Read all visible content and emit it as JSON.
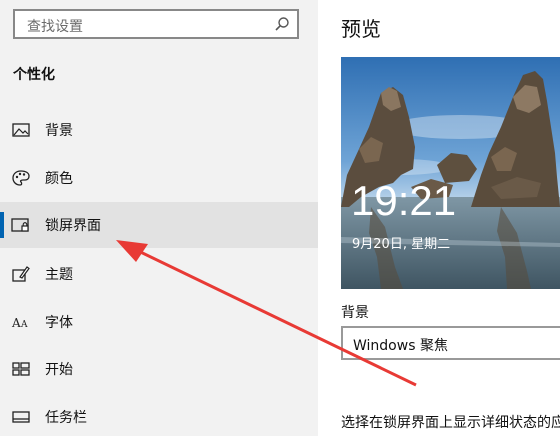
{
  "search": {
    "placeholder": "查找设置"
  },
  "sidebar": {
    "section_title": "个性化",
    "items": [
      {
        "label": "背景",
        "icon": "image-icon"
      },
      {
        "label": "颜色",
        "icon": "palette-icon"
      },
      {
        "label": "锁屏界面",
        "icon": "lock-screen-icon",
        "selected": true
      },
      {
        "label": "主题",
        "icon": "theme-brush-icon"
      },
      {
        "label": "字体",
        "icon": "font-icon"
      },
      {
        "label": "开始",
        "icon": "start-grid-icon"
      },
      {
        "label": "任务栏",
        "icon": "taskbar-icon"
      }
    ]
  },
  "main": {
    "title": "预览",
    "preview": {
      "time": "19:21",
      "date": "9月20日, 星期二"
    },
    "background_label": "背景",
    "background_value": "Windows 聚焦",
    "description": "选择在锁屏界面上显示详细状态的应"
  },
  "colors": {
    "accent": "#0063b1",
    "annotation_arrow": "#e83a35"
  }
}
